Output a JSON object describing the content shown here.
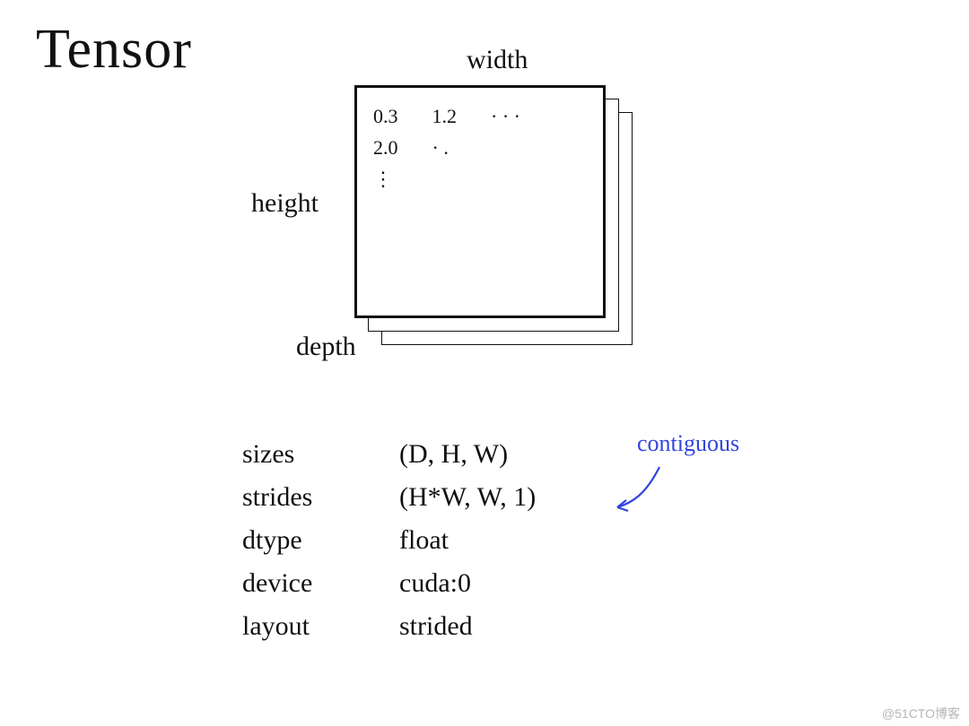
{
  "title": "Tensor",
  "dimensions": {
    "width_label": "width",
    "height_label": "height",
    "depth_label": "depth"
  },
  "matrix_sample": {
    "r0c0": "0.3",
    "r0c1": "1.2",
    "r0c2": "· · ·",
    "r1c0": "2.0",
    "r1c1": "· .",
    "r2c0": "⋮"
  },
  "properties": {
    "sizes": {
      "key": "sizes",
      "value": "(D, H, W)"
    },
    "strides": {
      "key": "strides",
      "value": "(H*W, W, 1)"
    },
    "dtype": {
      "key": "dtype",
      "value": "float"
    },
    "device": {
      "key": "device",
      "value": "cuda:0"
    },
    "layout": {
      "key": "layout",
      "value": "strided"
    }
  },
  "annotation": "contiguous",
  "annotation_color": "#3344dd",
  "watermark": "@51CTO博客"
}
